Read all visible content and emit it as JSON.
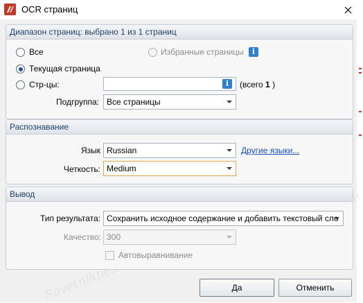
{
  "window": {
    "title": "OCR страниц",
    "accent_color": "#c0392b"
  },
  "page_range": {
    "header": "Диапазон страниц: выбрано 1 из 1 страниц",
    "options": {
      "all": "Все",
      "current": "Текущая страница",
      "pages": "Стр-цы:",
      "favorites": "Избранные страницы"
    },
    "selected": "current",
    "pages_input_value": "",
    "total_label": "(всего",
    "total_value": "1",
    "total_close": ")",
    "subset_label": "Подгруппа:",
    "subset_value": "Все страницы"
  },
  "recognition": {
    "header": "Распознавание",
    "language_label": "Язык",
    "language_value": "Russian",
    "other_languages_link": "Другие языки...",
    "accuracy_label": "Четкость:",
    "accuracy_value": "Medium"
  },
  "output": {
    "header": "Вывод",
    "result_type_label": "Тип результата:",
    "result_type_value": "Сохранить исходное содержание и добавить текстовый сло",
    "quality_label": "Качество:",
    "quality_value": "300",
    "autodeskew_label": "Автовыравнивание",
    "autodeskew_checked": false
  },
  "buttons": {
    "ok": "Да",
    "cancel": "Отменить"
  },
  "watermark_text": "Sovetnikpc.com"
}
